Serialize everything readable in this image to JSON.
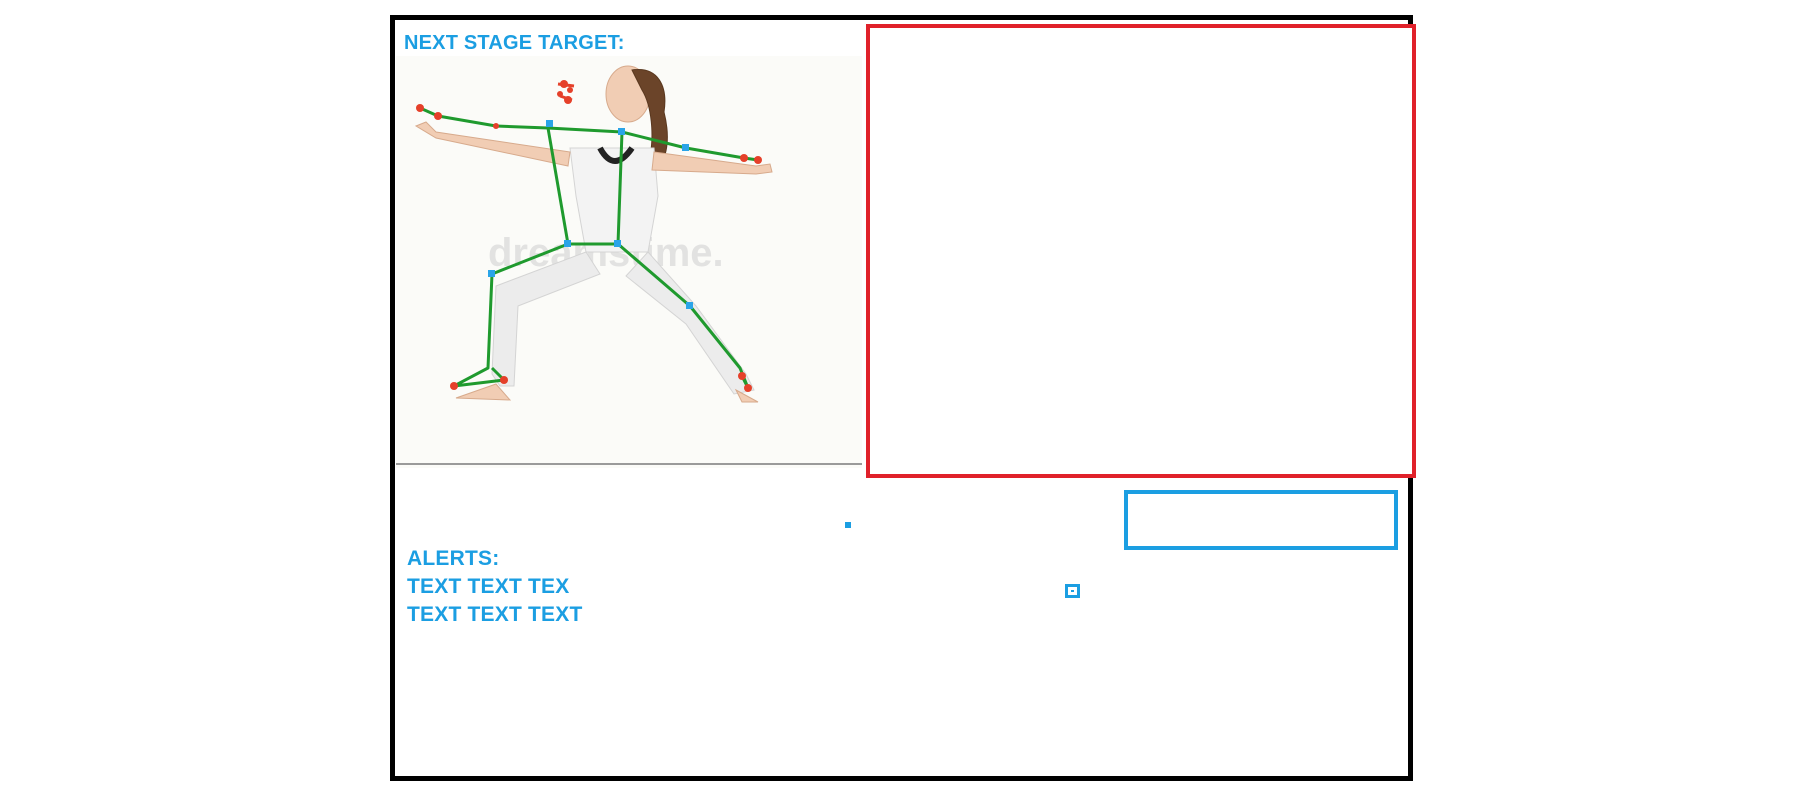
{
  "colors": {
    "accent": "#1b9ee2",
    "camera_border": "#e0212a",
    "frame_border": "#000000",
    "skeleton_line": "#1f9a2e",
    "joint_red": "#e5402a",
    "joint_blue": "#2aa4e8"
  },
  "stage": {
    "title": "NEXT STAGE TARGET:"
  },
  "target_image": {
    "description_icon": "yoga-warrior-pose-skeleton-image",
    "watermark": "dreamstime."
  },
  "alerts": {
    "title": "ALERTS:",
    "lines": [
      "TEXT TEXT TEX",
      "TEXT TEXT TEXT"
    ]
  }
}
